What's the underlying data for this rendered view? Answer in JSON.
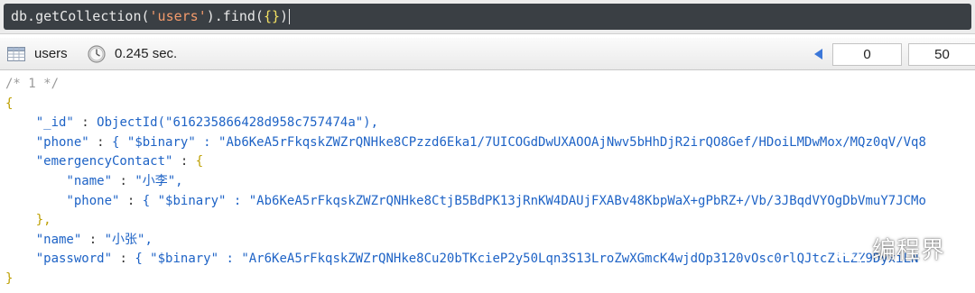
{
  "query": {
    "text_prefix": "db.getCollection(",
    "collection_string": "'users'",
    "text_middle": ").find(",
    "brace": "{}",
    "text_suffix": ")"
  },
  "toolbar": {
    "collection_name": "users",
    "elapsed": "0.245 sec.",
    "skip_value": "0",
    "limit_value": "50",
    "accent_color": "#3b77d9"
  },
  "document": {
    "comment": "/* 1 */",
    "open_brace": "{",
    "close_brace": "}",
    "lines": [
      {
        "indent": "    ",
        "key": "\"_id\"",
        "sep": " : ",
        "value": "ObjectId(\"616235866428d958c757474a\"),",
        "kind": "plain"
      },
      {
        "indent": "    ",
        "key": "\"phone\"",
        "sep": " : ",
        "value": "{ \"$binary\" : \"Ab6KeA5rFkqskZWZrQNHke8CPzzd6Eka1/7UICOGdDwUXAOOAjNwv5bHhDjR2irQO8Gef/HDoiLMDwMox/MQz0qV/Vq8",
        "kind": "plain"
      },
      {
        "indent": "    ",
        "key": "\"emergencyContact\"",
        "sep": " : ",
        "value": "{",
        "kind": "brace"
      },
      {
        "indent": "        ",
        "key": "\"name\"",
        "sep": " : ",
        "value": "\"小李\",",
        "kind": "plain"
      },
      {
        "indent": "        ",
        "key": "\"phone\"",
        "sep": " : ",
        "value": "{ \"$binary\" : \"Ab6KeA5rFkqskZWZrQNHke8CtjB5BdPK13jRnKW4DAUjFXABv48KbpWaX+gPbRZ+/Vb/3JBqdVYOgDbVmuY7JCMo",
        "kind": "plain"
      },
      {
        "indent": "    ",
        "key": "",
        "sep": "",
        "value": "},",
        "kind": "brace"
      },
      {
        "indent": "    ",
        "key": "\"name\"",
        "sep": " : ",
        "value": "\"小张\",",
        "kind": "plain"
      },
      {
        "indent": "    ",
        "key": "\"password\"",
        "sep": " : ",
        "value": "{ \"$binary\" : \"Ar6KeA5rFkqskZWZrQNHke8Cu20bTKcieP2y50Lqn3S13LroZwXGmcK4wjdOp3120vOsc0rlQJtcZlLZZ9DyxiLN",
        "kind": "plain"
      }
    ]
  },
  "watermark": {
    "text": "编程界",
    "icon": "wechat-icon"
  }
}
